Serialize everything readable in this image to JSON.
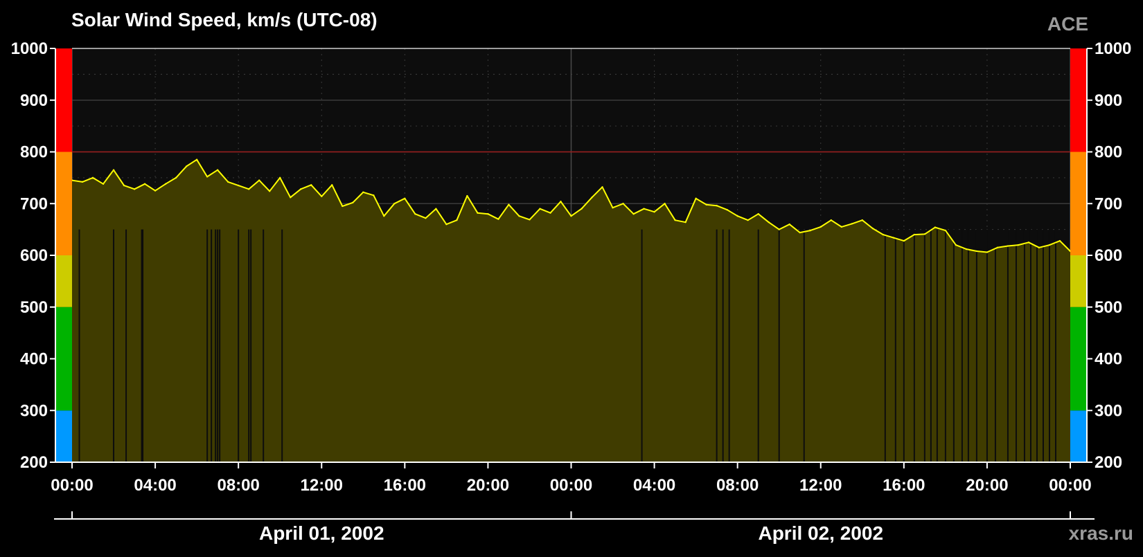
{
  "chart_data": {
    "type": "area",
    "title": "Solar Wind Speed, km/s (UTC-08)",
    "badge": "ACE",
    "watermark": "xras.ru",
    "ylim": [
      200,
      1000
    ],
    "y_ticks": [
      200,
      300,
      400,
      500,
      600,
      700,
      800,
      900,
      1000
    ],
    "y_tick_labels": [
      "200",
      "300",
      "400",
      "500",
      "600",
      "700",
      "800",
      "900",
      "1000"
    ],
    "xlim_hours": [
      0,
      48
    ],
    "x_ticks_hours": [
      0,
      4,
      8,
      12,
      16,
      20,
      24,
      28,
      32,
      36,
      40,
      44,
      48
    ],
    "x_tick_labels": [
      "00:00",
      "04:00",
      "08:00",
      "12:00",
      "16:00",
      "20:00",
      "00:00",
      "04:00",
      "08:00",
      "12:00",
      "16:00",
      "20:00",
      "00:00"
    ],
    "date_labels": [
      "April 01, 2002",
      "April 02, 2002"
    ],
    "threshold_line": 800,
    "grid": true,
    "colors": {
      "background": "#000000",
      "plot_bg": "#0d0d0d",
      "line": "#ffff00",
      "fill": "#403c00",
      "threshold": "#9b1b1b"
    },
    "scale_bands": [
      {
        "from": 200,
        "to": 300,
        "color": "#0099ff"
      },
      {
        "from": 300,
        "to": 500,
        "color": "#00b300"
      },
      {
        "from": 500,
        "to": 600,
        "color": "#cccc00"
      },
      {
        "from": 600,
        "to": 800,
        "color": "#ff8c00"
      },
      {
        "from": 800,
        "to": 1000,
        "color": "#ff0000"
      }
    ],
    "series": [
      {
        "x_hours": [
          0,
          0.5,
          1,
          1.5,
          2,
          2.5,
          3,
          3.5,
          4,
          4.5,
          5,
          5.5,
          6,
          6.5,
          7,
          7.5,
          8,
          8.5,
          9,
          9.5,
          10,
          10.5,
          11,
          11.5,
          12,
          12.5,
          13,
          13.5,
          14,
          14.5,
          15,
          15.5,
          16,
          16.5,
          17,
          17.5,
          18,
          18.5,
          19,
          19.5,
          20,
          20.5,
          21,
          21.5,
          22,
          22.5,
          23,
          23.5,
          24,
          24.5,
          25,
          25.5,
          26,
          26.5,
          27,
          27.5,
          28,
          28.5,
          29,
          29.5,
          30,
          30.5,
          31,
          31.5,
          32,
          32.5,
          33,
          33.5,
          34,
          34.5,
          35,
          35.5,
          36,
          36.5,
          37,
          37.5,
          38,
          38.5,
          39,
          39.5,
          40,
          40.5,
          41,
          41.5,
          42,
          42.5,
          43,
          43.5,
          44,
          44.5,
          45,
          45.5,
          46,
          46.5,
          47,
          47.5,
          48
        ],
        "values": [
          745,
          742,
          750,
          738,
          765,
          735,
          728,
          738,
          725,
          738,
          750,
          772,
          785,
          752,
          765,
          742,
          735,
          728,
          745,
          724,
          750,
          712,
          728,
          736,
          714,
          736,
          695,
          702,
          722,
          716,
          676,
          700,
          710,
          680,
          672,
          690,
          660,
          668,
          715,
          682,
          680,
          670,
          698,
          676,
          669,
          690,
          682,
          704,
          676,
          690,
          712,
          732,
          692,
          700,
          680,
          690,
          684,
          700,
          668,
          664,
          710,
          698,
          696,
          688,
          676,
          668,
          680,
          664,
          650,
          660,
          644,
          648,
          655,
          668,
          655,
          661,
          668,
          652,
          640,
          634,
          628,
          640,
          641,
          654,
          648,
          620,
          612,
          608,
          606,
          615,
          618,
          620,
          625,
          615,
          620,
          628,
          608,
          600,
          606,
          600,
          602,
          599
        ]
      }
    ],
    "gaps_hours": [
      0.35,
      2,
      2.6,
      3.35,
      3.4,
      6.5,
      6.7,
      6.9,
      7.0,
      7.1,
      8.0,
      8.5,
      8.6,
      9.2,
      10.1,
      27.4,
      31.0,
      31.3,
      31.6,
      33.0,
      34.0,
      35.2,
      39.1,
      39.6,
      40.0,
      40.5,
      41.0,
      41.3,
      41.6,
      42.0,
      42.4,
      42.8,
      43.1,
      43.5,
      44.0,
      44.4,
      45.0,
      45.4,
      45.8,
      46.1,
      46.4,
      46.7,
      47.0,
      47.3
    ]
  }
}
